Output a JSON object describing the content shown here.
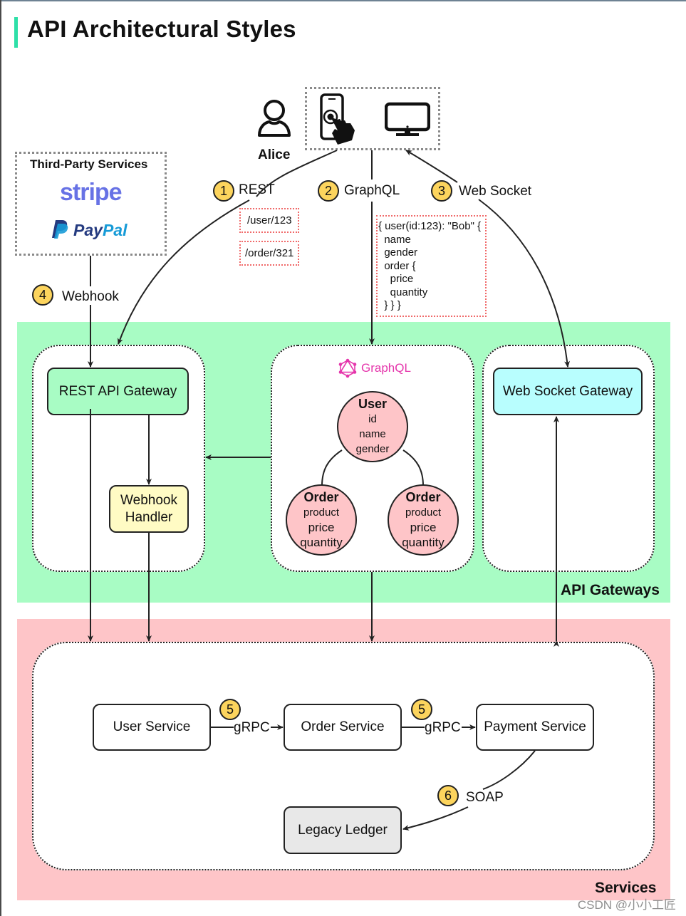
{
  "title": "API Architectural Styles",
  "colors": {
    "title_accent": "#2ee0a8",
    "gateway_zone": "#a8fcc4",
    "services_zone": "#fec5c8",
    "badge": "#fcd45d",
    "rest_gateway": "#a8fcc4",
    "webhook_handler": "#fffbc4",
    "websocket_gateway": "#b8fefe",
    "legacy_ledger": "#e8e8e8",
    "graphql_brand": "#e535ab",
    "stripe_brand": "#6772e5",
    "paypal_dark": "#253b80",
    "paypal_light": "#179bd7"
  },
  "client": {
    "user_icon": "person-icon",
    "user_name": "Alice",
    "devices": [
      {
        "icon": "smartphone-touch-icon"
      },
      {
        "icon": "desktop-monitor-icon"
      }
    ]
  },
  "third_party": {
    "title": "Third-Party Services",
    "logos": [
      "stripe",
      "PayPal"
    ]
  },
  "styles": [
    {
      "number": "1",
      "label": "REST"
    },
    {
      "number": "2",
      "label": "GraphQL"
    },
    {
      "number": "3",
      "label": "Web Socket"
    },
    {
      "number": "4",
      "label": "Webhook"
    },
    {
      "number": "5",
      "label": "gRPC"
    },
    {
      "number": "6",
      "label": "SOAP"
    }
  ],
  "rest_examples": [
    "/user/123",
    "/order/321"
  ],
  "graphql_query": "{ user(id:123): \"Bob\" {\n  name\n  gender\n  order {\n    price\n    quantity\n  } } }",
  "gateways": {
    "zone_label": "API Gateways",
    "rest_gateway": "REST API Gateway",
    "webhook_handler": "Webhook\nHandler",
    "graphql_logo_text": "GraphQL",
    "websocket_gateway": "Web Socket Gateway",
    "schema": {
      "user": {
        "title": "User",
        "fields": [
          "id",
          "name",
          "gender"
        ]
      },
      "orders": [
        {
          "title": "Order",
          "fields": [
            "product",
            "price",
            "quantity"
          ]
        },
        {
          "title": "Order",
          "fields": [
            "product",
            "price",
            "quantity"
          ]
        }
      ]
    }
  },
  "services": {
    "zone_label": "Services",
    "user_service": "User Service",
    "order_service": "Order Service",
    "payment_service": "Payment Service",
    "legacy_ledger": "Legacy Ledger",
    "grpc_label": "gRPC",
    "grpc_badge": "5",
    "soap_label": "SOAP",
    "soap_badge": "6"
  },
  "watermark": "CSDN @小小工匠"
}
